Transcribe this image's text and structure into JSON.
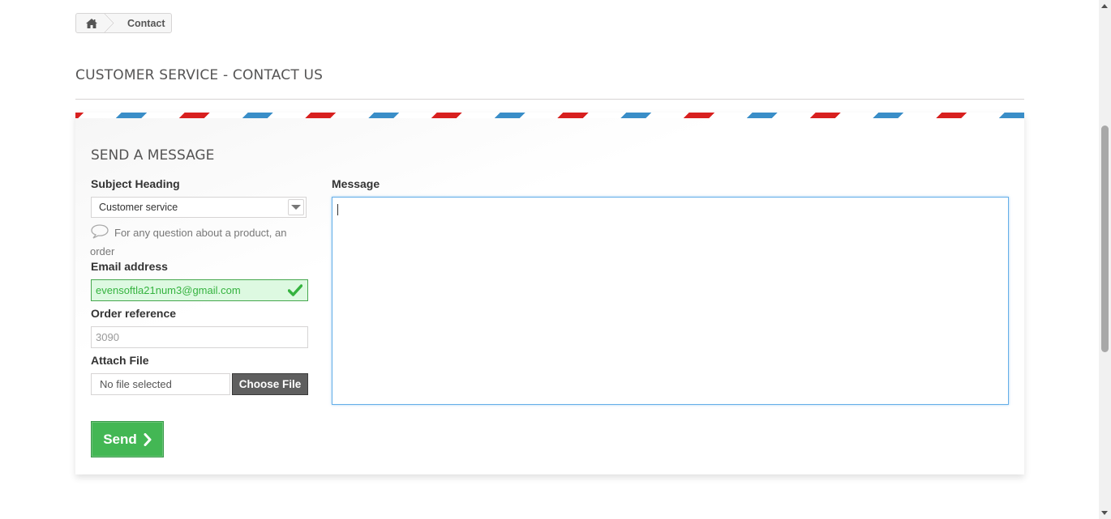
{
  "breadcrumb": {
    "home_icon": "home-icon",
    "current": "Contact"
  },
  "page": {
    "title": "CUSTOMER SERVICE - CONTACT US"
  },
  "form": {
    "section_title": "SEND A MESSAGE",
    "subject": {
      "label": "Subject Heading",
      "selected": "Customer service",
      "hint": "For any question about a product, an order"
    },
    "email": {
      "label": "Email address",
      "value": "evensoftla21num3@gmail.com",
      "status_icon": "check-icon"
    },
    "order_reference": {
      "label": "Order reference",
      "value": "3090"
    },
    "attach": {
      "label": "Attach File",
      "filename": "No file selected",
      "button_label": "Choose File"
    },
    "message": {
      "label": "Message",
      "value": ""
    },
    "send_label": "Send"
  },
  "colors": {
    "stripe_blue": "#3a8ec8",
    "stripe_red": "#d8201f",
    "send_green": "#43b754",
    "valid_green": "#35b33f",
    "valid_bg": "#ddf9e1",
    "focus_blue": "#66afe9"
  }
}
